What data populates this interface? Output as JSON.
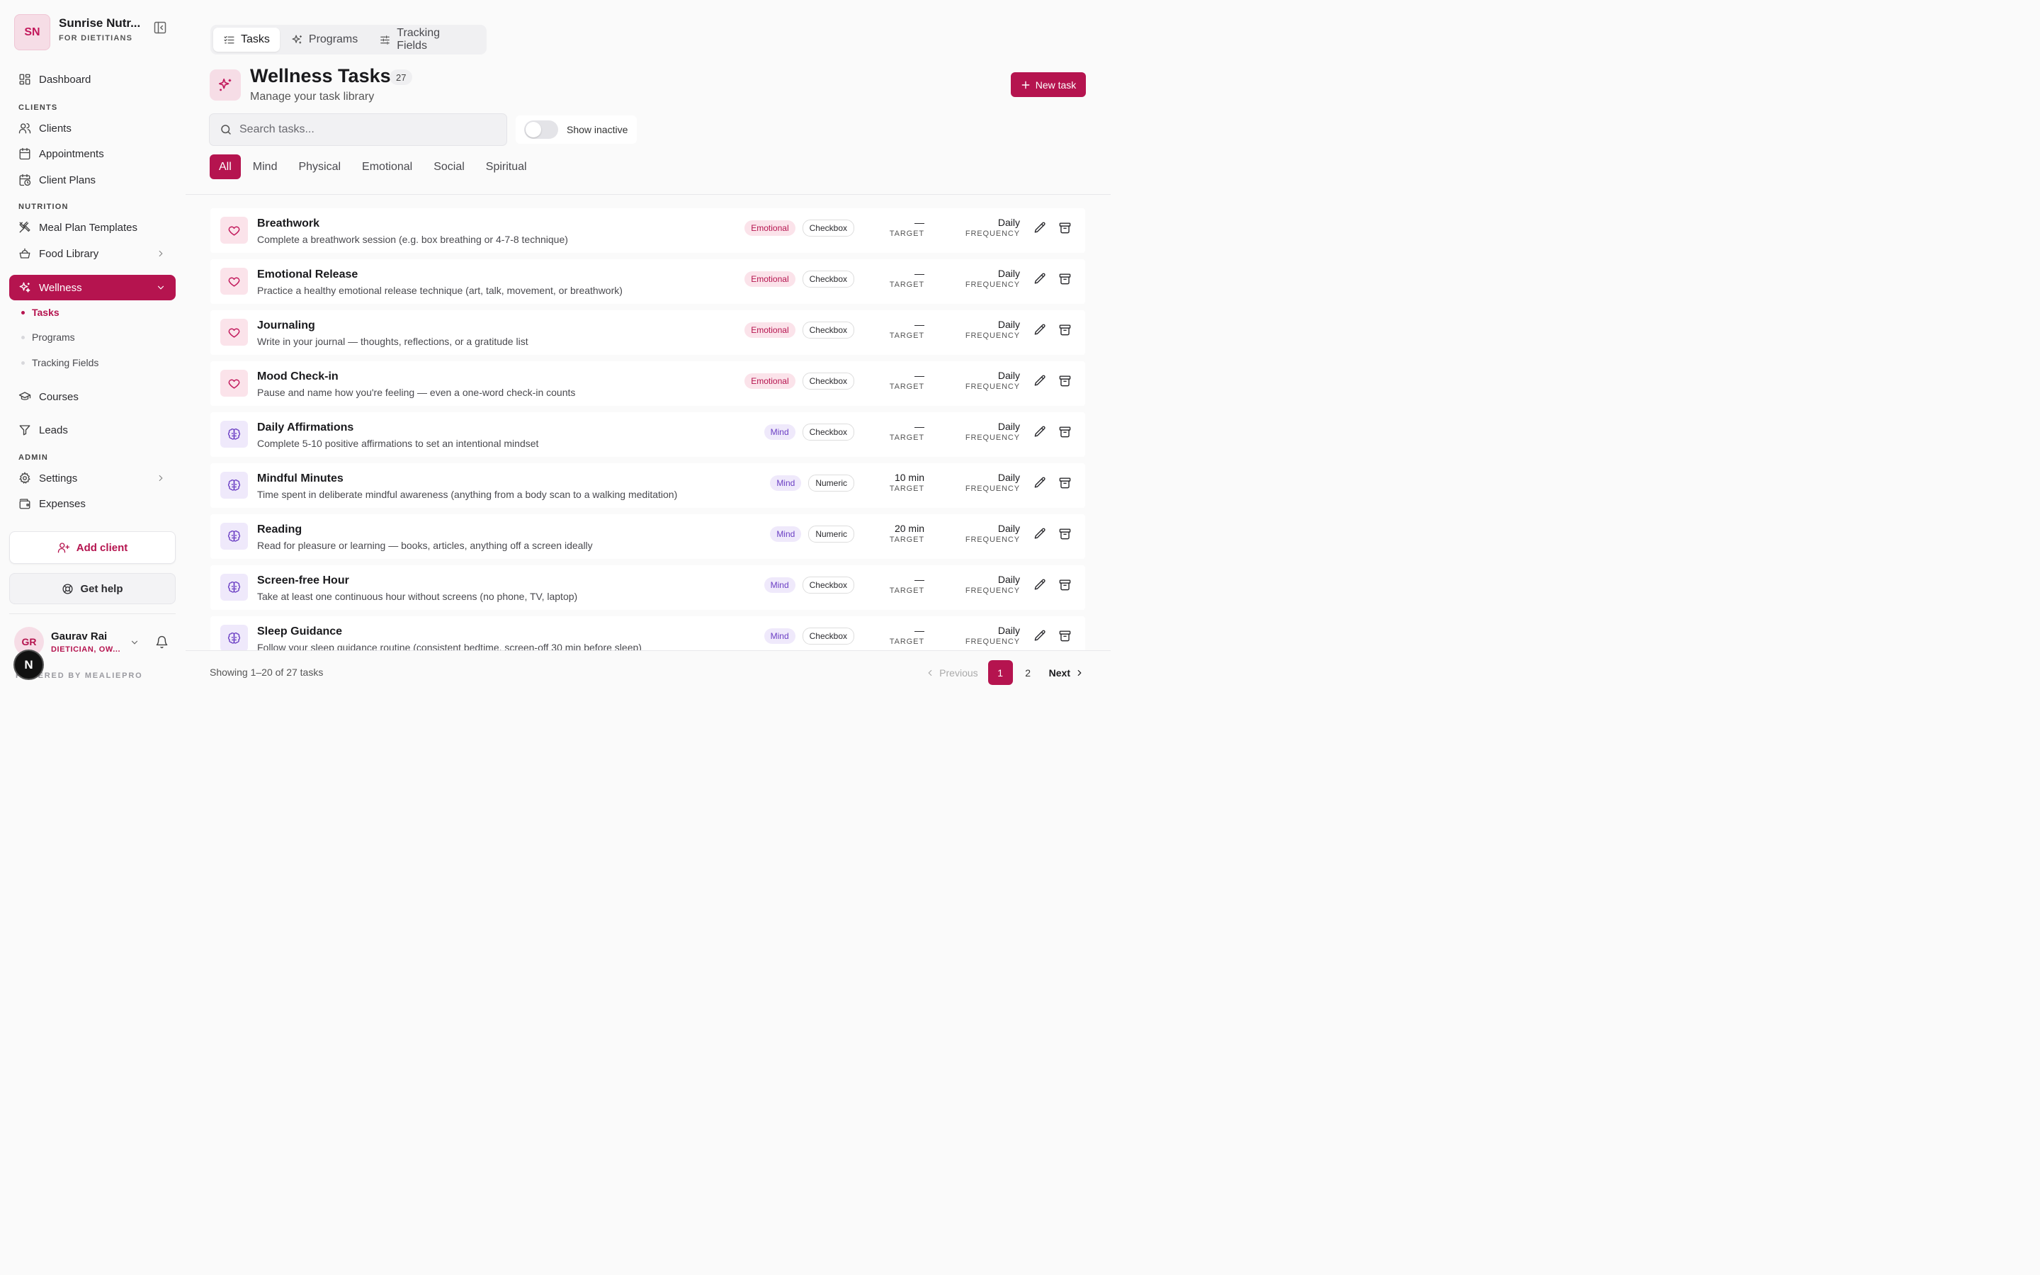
{
  "brand": {
    "initials": "SN",
    "name": "Sunrise Nutr...",
    "subtitle": "FOR DIETITIANS"
  },
  "sidebar": {
    "dashboard": "Dashboard",
    "sections": {
      "clients": "CLIENTS",
      "nutrition": "NUTRITION",
      "admin": "ADMIN"
    },
    "clients": "Clients",
    "appointments": "Appointments",
    "client_plans": "Client Plans",
    "meal_plan_templates": "Meal Plan Templates",
    "food_library": "Food Library",
    "wellness": "Wellness",
    "wellness_sub": [
      "Tasks",
      "Programs",
      "Tracking Fields"
    ],
    "courses": "Courses",
    "leads": "Leads",
    "settings": "Settings",
    "expenses": "Expenses",
    "add_client": "Add client",
    "get_help": "Get help"
  },
  "user": {
    "initials": "GR",
    "name": "Gaurav Rai",
    "role": "DIETICIAN, OW..."
  },
  "powered_by": "POWERED BY MEALIEPRO",
  "n_badge": "N",
  "top_tabs": [
    "Tasks",
    "Programs",
    "Tracking Fields"
  ],
  "page": {
    "title": "Wellness Tasks",
    "count": "27",
    "subtitle": "Manage your task library",
    "new_task": "New task"
  },
  "search": {
    "placeholder": "Search tasks..."
  },
  "toggle": {
    "label": "Show inactive"
  },
  "filters": [
    "All",
    "Mind",
    "Physical",
    "Emotional",
    "Social",
    "Spiritual"
  ],
  "labels": {
    "target": "TARGET",
    "frequency": "FREQUENCY"
  },
  "tasks": [
    {
      "title": "Breathwork",
      "desc": "Complete a breathwork session (e.g. box breathing or 4-7-8 technique)",
      "category": "Emotional",
      "type": "Checkbox",
      "target": "—",
      "frequency": "Daily"
    },
    {
      "title": "Emotional Release",
      "desc": "Practice a healthy emotional release technique (art, talk, movement, or breathwork)",
      "category": "Emotional",
      "type": "Checkbox",
      "target": "—",
      "frequency": "Daily"
    },
    {
      "title": "Journaling",
      "desc": "Write in your journal — thoughts, reflections, or a gratitude list",
      "category": "Emotional",
      "type": "Checkbox",
      "target": "—",
      "frequency": "Daily"
    },
    {
      "title": "Mood Check-in",
      "desc": "Pause and name how you're feeling — even a one-word check-in counts",
      "category": "Emotional",
      "type": "Checkbox",
      "target": "—",
      "frequency": "Daily"
    },
    {
      "title": "Daily Affirmations",
      "desc": "Complete 5-10 positive affirmations to set an intentional mindset",
      "category": "Mind",
      "type": "Checkbox",
      "target": "—",
      "frequency": "Daily"
    },
    {
      "title": "Mindful Minutes",
      "desc": "Time spent in deliberate mindful awareness (anything from a body scan to a walking meditation)",
      "category": "Mind",
      "type": "Numeric",
      "target": "10 min",
      "frequency": "Daily"
    },
    {
      "title": "Reading",
      "desc": "Read for pleasure or learning — books, articles, anything off a screen ideally",
      "category": "Mind",
      "type": "Numeric",
      "target": "20 min",
      "frequency": "Daily"
    },
    {
      "title": "Screen-free Hour",
      "desc": "Take at least one continuous hour without screens (no phone, TV, laptop)",
      "category": "Mind",
      "type": "Checkbox",
      "target": "—",
      "frequency": "Daily"
    },
    {
      "title": "Sleep Guidance",
      "desc": "Follow your sleep guidance routine (consistent bedtime, screen-off 30 min before sleep)",
      "category": "Mind",
      "type": "Checkbox",
      "target": "—",
      "frequency": "Daily"
    }
  ],
  "footer": {
    "showing": "Showing 1–20 of 27 tasks",
    "previous": "Previous",
    "pages": [
      "1",
      "2"
    ],
    "next": "Next"
  }
}
